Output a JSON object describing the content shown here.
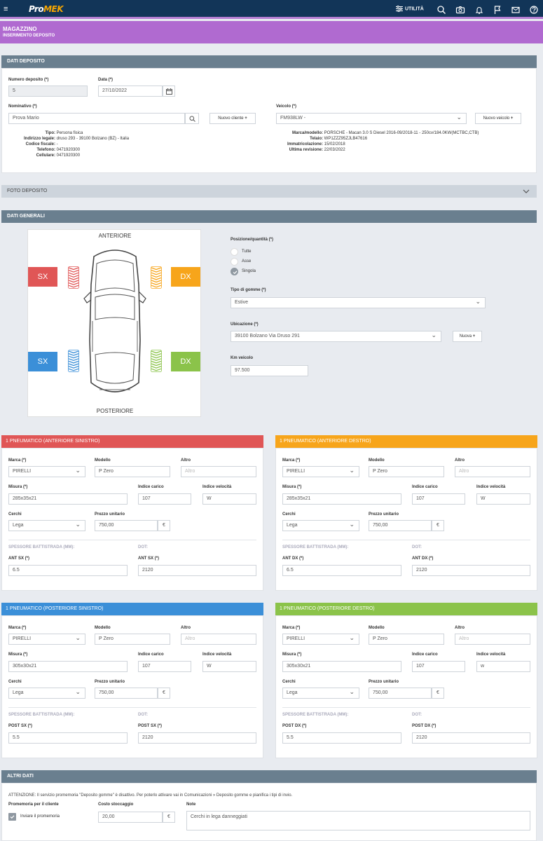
{
  "topbar": {
    "logo_pre": "Pro",
    "logo_hl": "MEK",
    "utility": "UTILITÀ"
  },
  "header": {
    "title": "MAGAZZINO",
    "subtitle": "INSERIMENTO DEPOSITO"
  },
  "deposito": {
    "title": "DATI DEPOSITO",
    "numero_label": "Numero deposito (*)",
    "numero_value": "5",
    "data_label": "Data (*)",
    "data_value": "27/10/2022",
    "nominativo_label": "Nominativo (*)",
    "nominativo_value": "Prova Mario",
    "nuovo_cliente": "Nuovo cliente",
    "veicolo_label": "Veicolo (*)",
    "veicolo_value": "FM938LW -",
    "nuovo_veicolo": "Nuovo veicolo",
    "cliente_info": [
      {
        "k": "Tipo:",
        "v": "Persona fisica"
      },
      {
        "k": "Indirizzo legale:",
        "v": "druso 293 - 39100 Bolzano (BZ) - Italia"
      },
      {
        "k": "Codice fiscale:",
        "v": "-"
      },
      {
        "k": "Telefono:",
        "v": "0471920300"
      },
      {
        "k": "Cellulare:",
        "v": "0471920300"
      }
    ],
    "veicolo_info": [
      {
        "k": "Marca/modello:",
        "v": "PORSCHE - Macan 3.0 S Diesel 2016-09/2018-11 - 250cv/184.0KW(MCTBC,CTB)"
      },
      {
        "k": "Telaio:",
        "v": "WP1ZZZ95ZJLB47616"
      },
      {
        "k": "Immatricolazione:",
        "v": "15/02/2018"
      },
      {
        "k": "Ultima revisione:",
        "v": "22/03/2022"
      }
    ]
  },
  "foto": {
    "title": "FOTO DEPOSITO"
  },
  "generali": {
    "title": "DATI GENERALI",
    "anteriore": "ANTERIORE",
    "posteriore": "POSTERIORE",
    "sx": "SX",
    "dx": "DX",
    "posizione_label": "Posizione/quantità (*)",
    "radios": [
      {
        "label": "Tutte",
        "on": false
      },
      {
        "label": "Asse",
        "on": false
      },
      {
        "label": "Singola",
        "on": true
      }
    ],
    "tipo_label": "Tipo di gomme (*)",
    "tipo_value": "Estive",
    "ubicazione_label": "Ubicazione (*)",
    "ubicazione_value": "39100 Bolzano Via Druso 291",
    "nuova": "Nuova",
    "km_label": "Km veicolo",
    "km_value": "97.500"
  },
  "colors": {
    "red": "#e05656",
    "orange": "#f7a51b",
    "blue": "#3b8fd8",
    "green": "#8bc34a"
  },
  "tyres": [
    {
      "title": "1 PNEUMATICO (ANTERIORE SINISTRO)",
      "color": "red",
      "marca": "PIRELLI",
      "modello": "P Zero",
      "altro": "Altro",
      "misura": "285x35x21",
      "indice_carico": "107",
      "indice_velocita": "W",
      "cerchi": "Lega",
      "prezzo": "750,00",
      "pos": "ANT SX (*)",
      "spessore": "6.5",
      "dot": "2120"
    },
    {
      "title": "1 PNEUMATICO (ANTERIORE DESTRO)",
      "color": "orange",
      "marca": "PIRELLI",
      "modello": "P Zero",
      "altro": "Altro",
      "misura": "285x35x21",
      "indice_carico": "107",
      "indice_velocita": "W",
      "cerchi": "Lega",
      "prezzo": "750,00",
      "pos": "ANT DX (*)",
      "spessore": "6.5",
      "dot": "2120"
    },
    {
      "title": "1 PNEUMATICO (POSTERIORE SINISTRO)",
      "color": "blue",
      "marca": "PIRELLI",
      "modello": "P Zero",
      "altro": "Altro",
      "misura": "305x30x21",
      "indice_carico": "107",
      "indice_velocita": "W",
      "cerchi": "Lega",
      "prezzo": "750,00",
      "pos": "POST SX (*)",
      "spessore": "5.5",
      "dot": "2120"
    },
    {
      "title": "1 PNEUMATICO (POSTERIORE DESTRO)",
      "color": "green",
      "marca": "PIRELLI",
      "modello": "P Zero",
      "altro": "Altro",
      "misura": "305x30x21",
      "indice_carico": "107",
      "indice_velocita": "w",
      "cerchi": "Lega",
      "prezzo": "750,00",
      "pos": "POST DX (*)",
      "spessore": "5.5",
      "dot": "2120"
    }
  ],
  "tyre_labels": {
    "marca": "Marca (*)",
    "modello": "Modello",
    "altro": "Altro",
    "misura": "Misura (*)",
    "indice_carico": "Indice carico",
    "indice_velocita": "Indice velocità",
    "cerchi": "Cerchi",
    "prezzo": "Prezzo unitario",
    "euro": "€",
    "spessore": "SPESSORE BATTISTRADA (MM):",
    "dot": "DOT:"
  },
  "altri": {
    "title": "ALTRI DATI",
    "notice": "ATTENZIONE: Il servizio promemoria \"Deposito gomme\" è disattivo. Per poterlo attivare vai in Comunicazioni » Deposito gomme e pianifica i tipi di invio.",
    "promemoria_label": "Promemoria per il cliente",
    "promemoria_check": "Inviare il promemoria",
    "costo_label": "Costo stoccaggio",
    "costo_value": "20,00",
    "euro": "€",
    "note_label": "Note",
    "note_value": "Cerchi in lega danneggiati"
  }
}
